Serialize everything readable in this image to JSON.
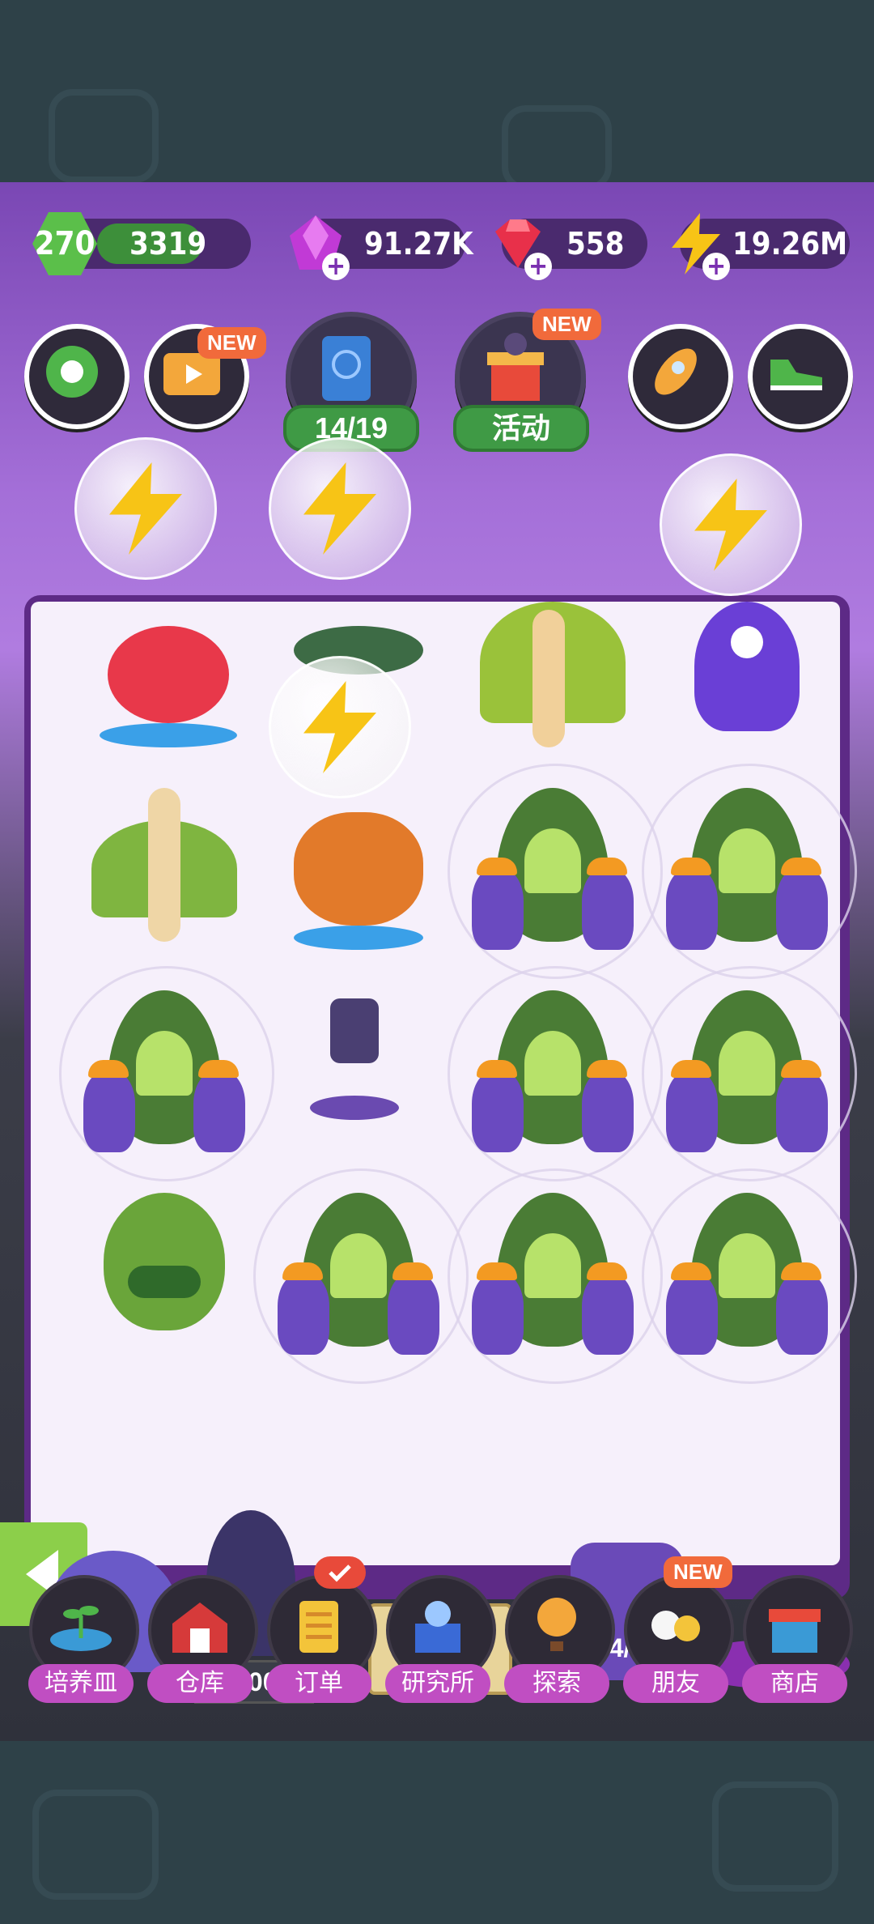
{
  "status": {
    "level": "270",
    "xp": "3319",
    "purple_gems": "91.27K",
    "red_gems": "558",
    "energy": "19.26M"
  },
  "top_buttons": {
    "video_new": "NEW",
    "collection_progress": "14/19",
    "event_new": "NEW",
    "event_label": "活动"
  },
  "board": {
    "storage_counter": "0/500K",
    "portal_counter": "4/4"
  },
  "nav": {
    "items": [
      {
        "label": "培养皿"
      },
      {
        "label": "仓库"
      },
      {
        "label": "订单"
      },
      {
        "label": "研究所"
      },
      {
        "label": "探索"
      },
      {
        "label": "朋友",
        "badge": "NEW"
      },
      {
        "label": "商店"
      }
    ]
  },
  "colors": {
    "purple": "#7a47b4",
    "green": "#3f9a45",
    "new_tag": "#f16a3b",
    "nav_label": "#c04ec2"
  }
}
